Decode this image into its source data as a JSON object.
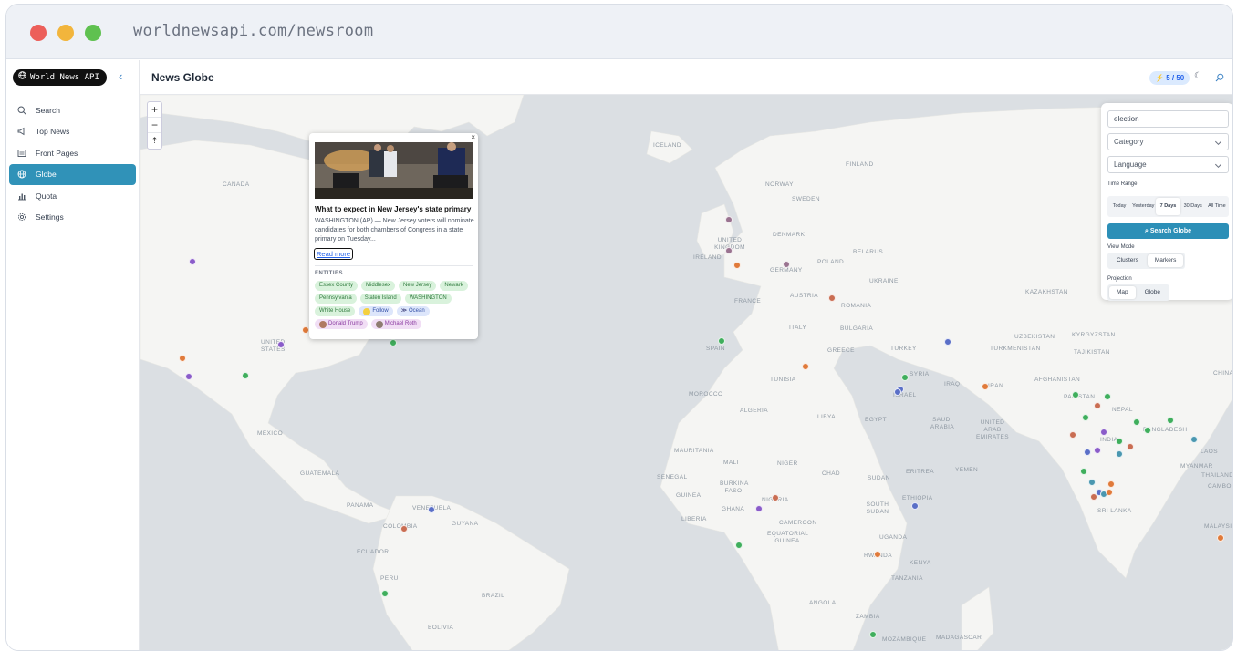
{
  "browser": {
    "url": "worldnewsapi.com/newsroom"
  },
  "sidebar": {
    "brand": "World News API",
    "collapse_icon": "chevron-left-icon",
    "items": [
      {
        "label": "Search",
        "icon": "search-icon",
        "active": false
      },
      {
        "label": "Top News",
        "icon": "megaphone-icon",
        "active": false
      },
      {
        "label": "Front Pages",
        "icon": "newspaper-icon",
        "active": false
      },
      {
        "label": "Globe",
        "icon": "globe-icon",
        "active": true
      },
      {
        "label": "Quota",
        "icon": "bar-chart-icon",
        "active": false
      },
      {
        "label": "Settings",
        "icon": "gear-icon",
        "active": false
      }
    ]
  },
  "header": {
    "title": "News Globe",
    "quota": "5 / 50"
  },
  "map": {
    "zoom_in": "+",
    "zoom_out": "−",
    "reset": "⇡",
    "labels": [
      "ICELAND",
      "FINLAND",
      "NORWAY",
      "SWEDEN",
      "CANADA",
      "UNITED KINGDOM",
      "IRELAND",
      "DENMARK",
      "GERMANY",
      "BELARUS",
      "POLAND",
      "UKRAINE",
      "FRANCE",
      "AUSTRIA",
      "ROMANIA",
      "KAZAKHSTAN",
      "ITALY",
      "BULGARIA",
      "UZBEKISTAN",
      "KYRGYZSTAN",
      "SPAIN",
      "GREECE",
      "TURKEY",
      "TURKMENISTAN",
      "TAJIKISTAN",
      "UNITED STATES",
      "TUNISIA",
      "SYRIA",
      "IRAQ",
      "IRAN",
      "AFGHANISTAN",
      "CHINA",
      "MOROCCO",
      "ALGERIA",
      "LIBYA",
      "EGYPT",
      "ISRAEL",
      "PAKISTAN",
      "NEPAL",
      "SAUDI ARABIA",
      "UNITED ARAB EMIRATES",
      "INDIA",
      "BANGLADESH",
      "MEXICO",
      "MAURITANIA",
      "MALI",
      "NIGER",
      "CHAD",
      "SUDAN",
      "ERITREA",
      "YEMEN",
      "MYANMAR",
      "LAOS",
      "GUATEMALA",
      "SENEGAL",
      "BURKINA FASO",
      "GUINEA",
      "NIGERIA",
      "ETHIOPIA",
      "THAILAND",
      "CAMBODIA",
      "PANAMA",
      "VENEZUELA",
      "GUYANA",
      "GHANA",
      "LIBERIA",
      "CAMEROON",
      "SOUTH SUDAN",
      "SRI LANKA",
      "COLOMBIA",
      "EQUATORIAL GUINEA",
      "UGANDA",
      "KENYA",
      "MALAYSIA",
      "ECUADOR",
      "RWANDA",
      "TANZANIA",
      "PERU",
      "BRAZIL",
      "ANGOLA",
      "ZAMBIA",
      "BOLIVIA",
      "MOZAMBIQUE",
      "MADAGASCAR"
    ]
  },
  "popup": {
    "title": "What to expect in New Jersey's state primary",
    "summary": "WASHINGTON (AP) — New Jersey voters will nominate candidates for both chambers of Congress in a state primary on Tuesday...",
    "read_more": "Read more",
    "entities_label": "ENTITIES",
    "entities": [
      {
        "label": "Essex County",
        "type": "loc"
      },
      {
        "label": "Middlesex",
        "type": "loc"
      },
      {
        "label": "New Jersey",
        "type": "loc"
      },
      {
        "label": "Newark",
        "type": "loc"
      },
      {
        "label": "Pennsylvania",
        "type": "loc"
      },
      {
        "label": "Staten Island",
        "type": "loc"
      },
      {
        "label": "WASHINGTON",
        "type": "loc"
      },
      {
        "label": "White House",
        "type": "loc"
      },
      {
        "label": "Follow",
        "type": "org"
      },
      {
        "label": "Ocean",
        "type": "org"
      },
      {
        "label": "Donald Trump",
        "type": "per"
      },
      {
        "label": "Michael Roth",
        "type": "per"
      }
    ]
  },
  "filters": {
    "query": "election",
    "category_placeholder": "Category",
    "language_placeholder": "Language",
    "time_range_label": "Time Range",
    "time_options": [
      "Today",
      "Yesterday",
      "7 Days",
      "30 Days",
      "All Time"
    ],
    "time_selected": "7 Days",
    "search_button": "Search Globe",
    "view_mode_label": "View Mode",
    "view_modes": [
      "Clusters",
      "Markers"
    ],
    "view_selected": "Markers",
    "projection_label": "Projection",
    "projections": [
      "Map",
      "Globe"
    ],
    "projection_selected": "Map"
  },
  "colors": {
    "accent": "#3092b8",
    "marker_green": "#3fae5c",
    "marker_orange": "#e07a3a",
    "marker_purple": "#8a5cc9",
    "marker_blue": "#5a6fc7",
    "marker_mauve": "#9a7390",
    "marker_teal": "#4a97b0",
    "marker_rust": "#c96d52"
  }
}
